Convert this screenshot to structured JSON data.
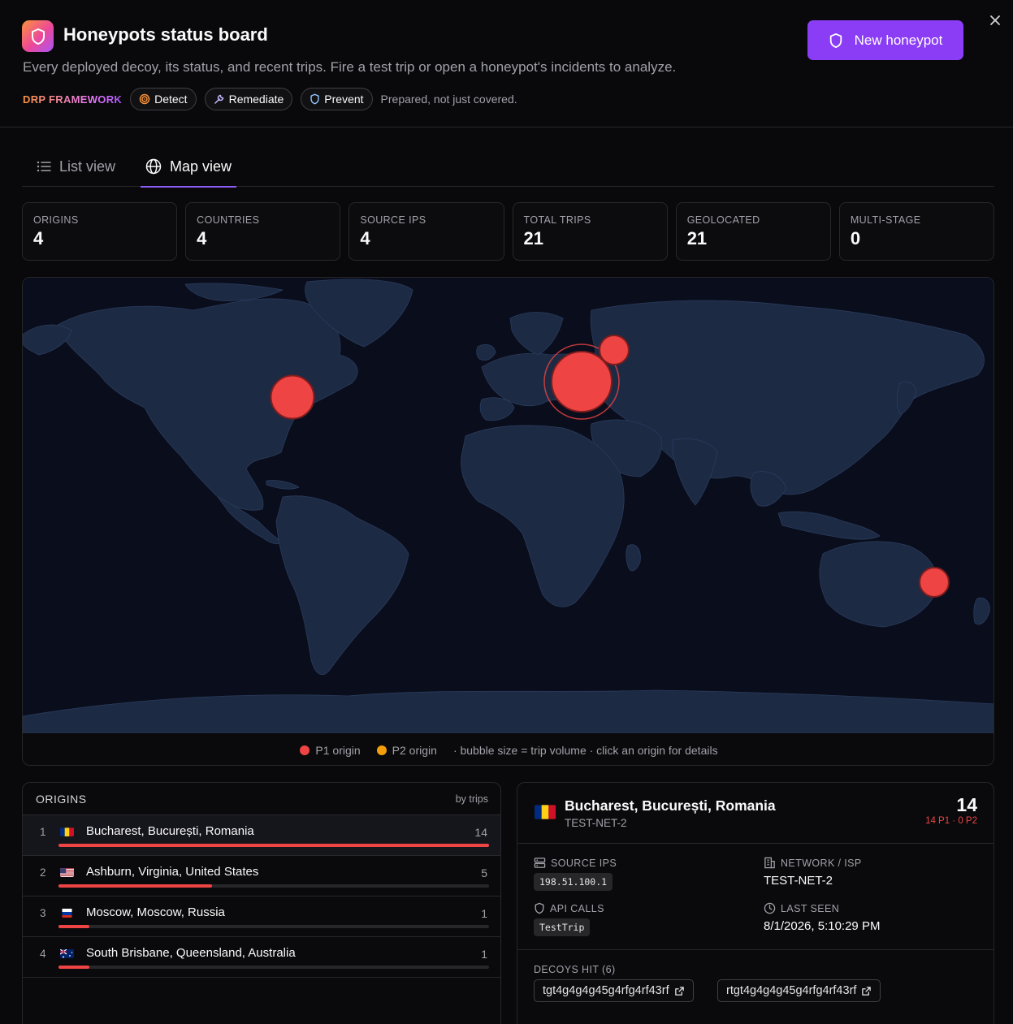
{
  "header": {
    "title": "Honeypots status board",
    "subtitle": "Every deployed decoy, its status, and recent trips. Fire a test trip or open a honeypot's incidents to analyze.",
    "new_button_label": "New honeypot",
    "drp_label": "DRP FRAMEWORK",
    "pills": [
      {
        "label": "Detect",
        "icon": "target-icon"
      },
      {
        "label": "Remediate",
        "icon": "wrench-icon"
      },
      {
        "label": "Prevent",
        "icon": "shield-icon"
      }
    ],
    "tagline": "Prepared, not just covered."
  },
  "tabs": [
    {
      "label": "List view",
      "icon": "list-icon",
      "active": false
    },
    {
      "label": "Map view",
      "icon": "globe-icon",
      "active": true
    }
  ],
  "stats": [
    {
      "label": "ORIGINS",
      "value": "4"
    },
    {
      "label": "COUNTRIES",
      "value": "4"
    },
    {
      "label": "SOURCE IPS",
      "value": "4"
    },
    {
      "label": "TOTAL TRIPS",
      "value": "21"
    },
    {
      "label": "GEOLOCATED",
      "value": "21"
    },
    {
      "label": "MULTI-STAGE",
      "value": "0"
    }
  ],
  "map": {
    "legend": {
      "p1": "P1 origin",
      "p2": "P2 origin",
      "note": "· bubble size = trip volume · click an origin for details"
    },
    "colors": {
      "p1": "#ef4444",
      "p2": "#f59e0b",
      "land": "#1c2a44",
      "ocean": "#0a0e1c"
    }
  },
  "origins": {
    "title": "ORIGINS",
    "sort_label": "by trips",
    "max": 14,
    "rows": [
      {
        "rank": "1",
        "name": "Bucharest, București, Romania",
        "count": "14",
        "trips": 14,
        "flag": "romania-flag",
        "selected": true
      },
      {
        "rank": "2",
        "name": "Ashburn, Virginia, United States",
        "count": "5",
        "trips": 5,
        "flag": "us-flag",
        "selected": false
      },
      {
        "rank": "3",
        "name": "Moscow, Moscow, Russia",
        "count": "1",
        "trips": 1,
        "flag": "russia-flag",
        "selected": false
      },
      {
        "rank": "4",
        "name": "South Brisbane, Queensland, Australia",
        "count": "1",
        "trips": 1,
        "flag": "australia-flag",
        "selected": false
      }
    ]
  },
  "detail": {
    "name": "Bucharest, București, Romania",
    "network": "TEST-NET-2",
    "total": "14",
    "split": "14 P1 · 0 P2",
    "source_ips_label": "SOURCE IPS",
    "source_ip": "198.51.100.1",
    "network_label": "NETWORK / ISP",
    "network_value": "TEST-NET-2",
    "api_calls_label": "API CALLS",
    "api_call": "TestTrip",
    "last_seen_label": "LAST SEEN",
    "last_seen": "8/1/2026, 5:10:29 PM",
    "decoys_label": "DECOYS HIT (6)",
    "decoys": [
      "tgt4g4g4g45g4rfg4rf43rf",
      "rtgt4g4g4g45g4rfg4rf43rf"
    ]
  }
}
